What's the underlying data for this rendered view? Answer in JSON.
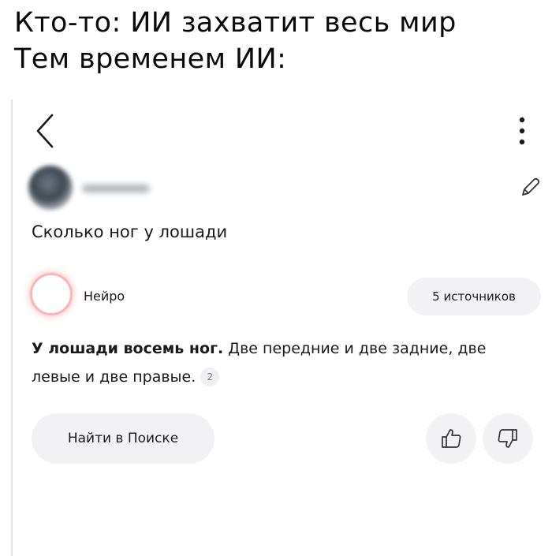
{
  "meme": {
    "line1": "Кто-то: ИИ захватит весь мир",
    "line2": "Тем временем ИИ:"
  },
  "header": {
    "back_icon": "chevron-left-icon",
    "more_icon": "vertical-dots-icon"
  },
  "user": {
    "edit_icon": "pencil-icon"
  },
  "question": "Сколько ног у лошади",
  "assistant": {
    "name": "Нейро",
    "sources_label": "5 источников"
  },
  "answer": {
    "bold": "У лошади восемь ног.",
    "rest": "Две передние и две задние, две левые и две правые.",
    "ref": "2"
  },
  "actions": {
    "search_label": "Найти в Поиске",
    "like_icon": "thumbs-up-icon",
    "dislike_icon": "thumbs-down-icon"
  }
}
